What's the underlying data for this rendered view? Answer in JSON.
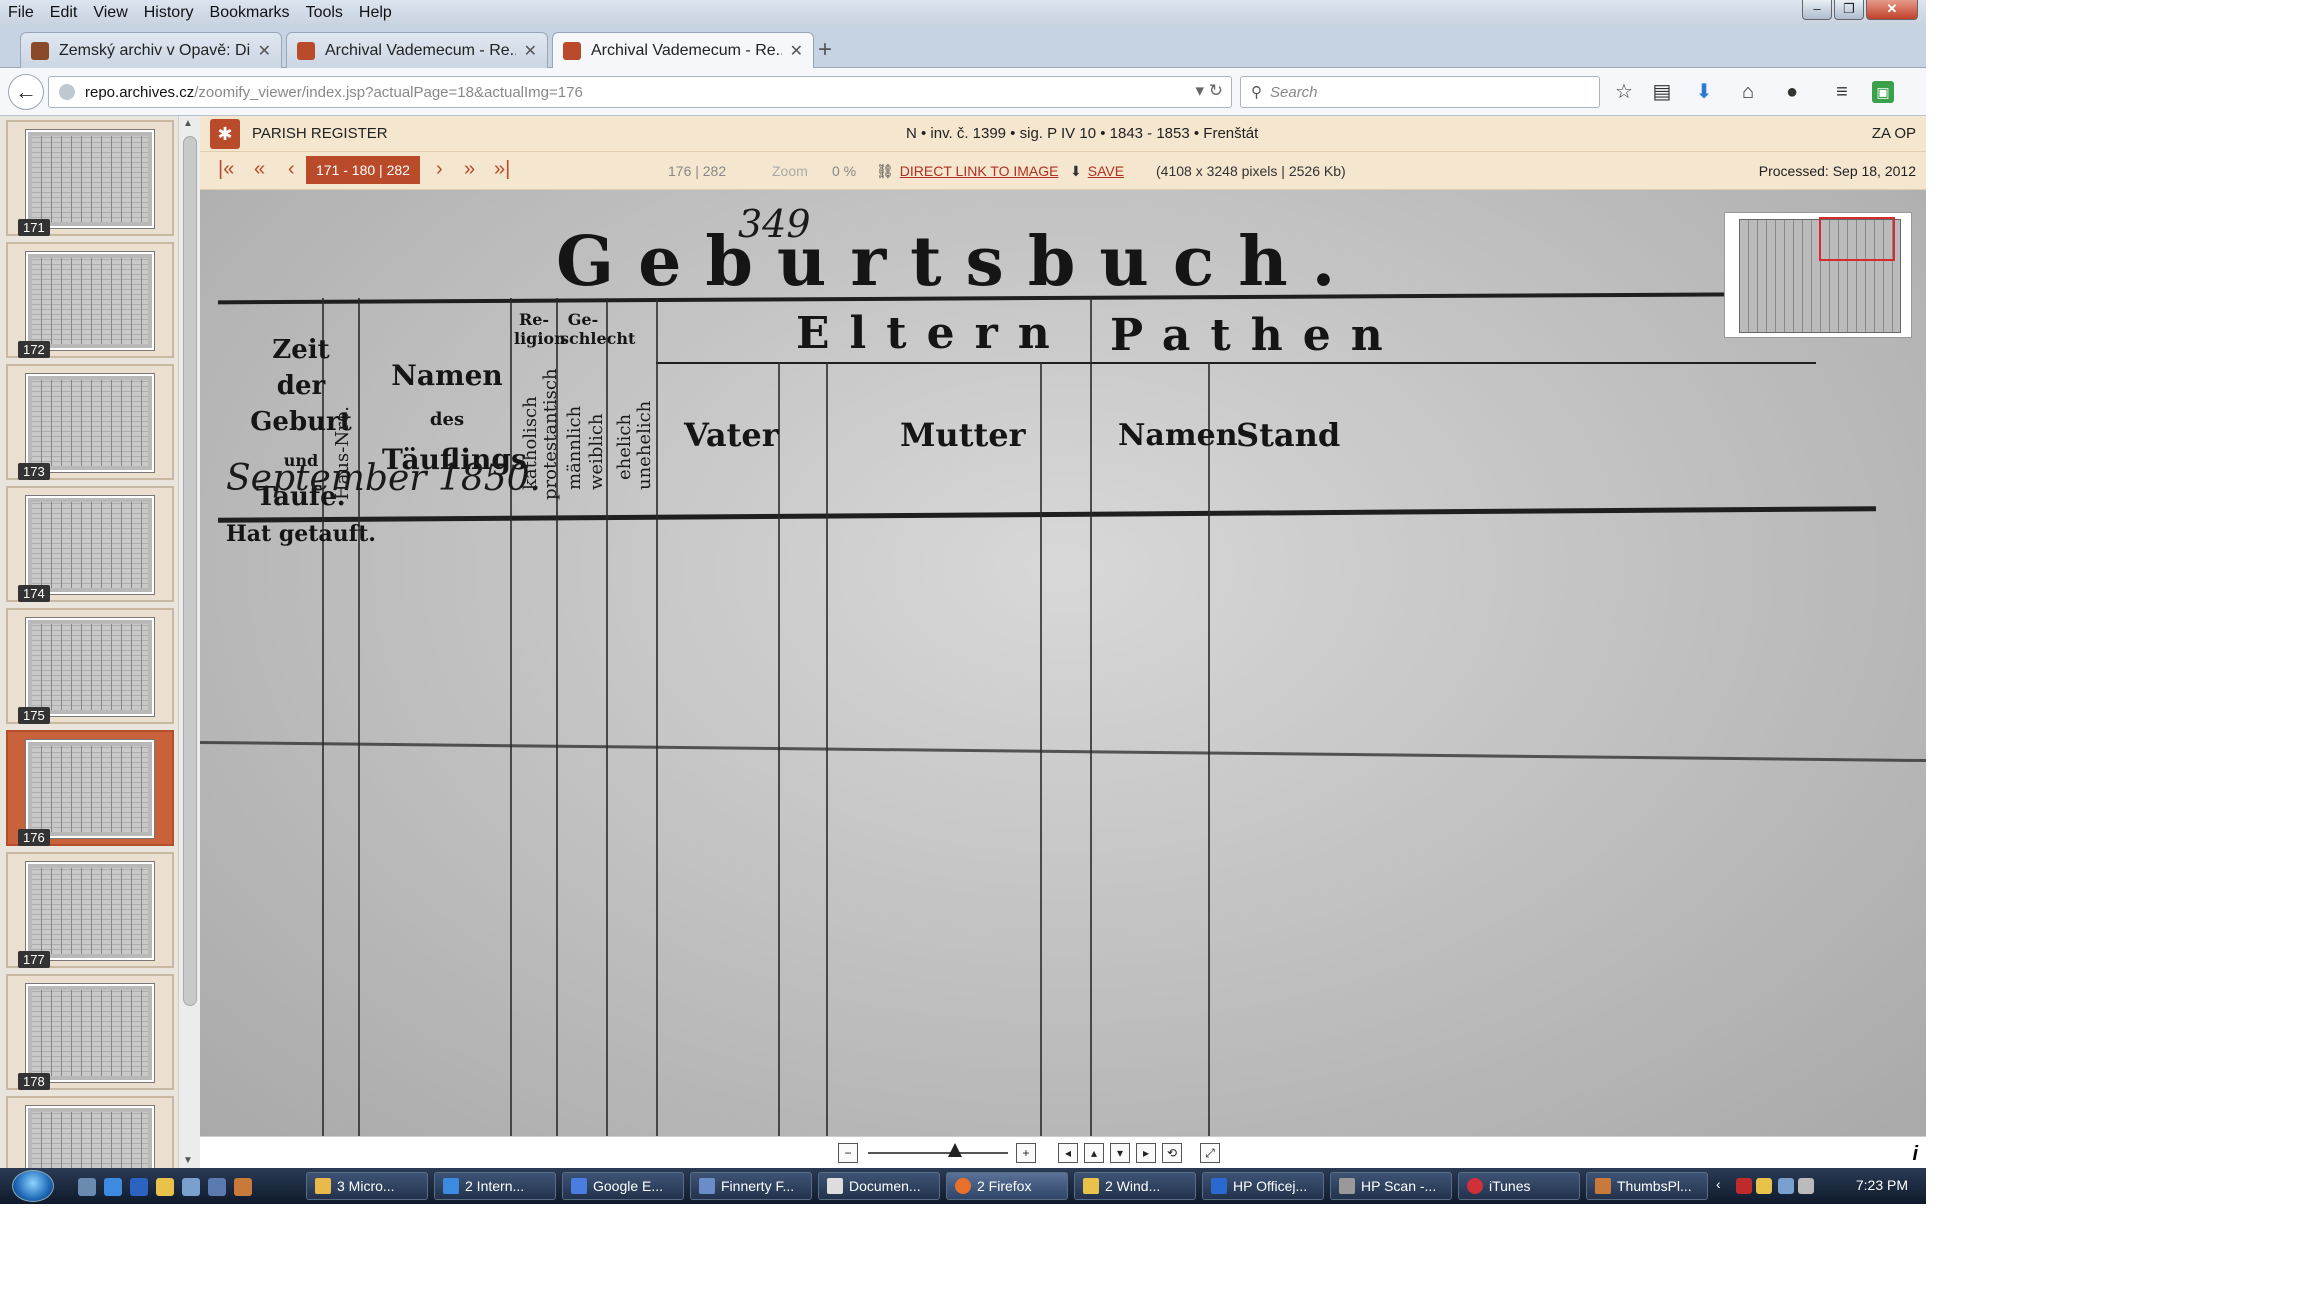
{
  "menubar": {
    "items": [
      "File",
      "Edit",
      "View",
      "History",
      "Bookmarks",
      "Tools",
      "Help"
    ]
  },
  "window_controls": {
    "minimize": "–",
    "restore": "❐",
    "close": "✕"
  },
  "tabs": [
    {
      "label": "Zemský archiv v Opavě: Di...",
      "icon": "archive-favicon",
      "color": "#8a4a2a"
    },
    {
      "label": "Archival Vademecum - Re...",
      "icon": "vademecum-favicon",
      "color": "#b94a2a"
    },
    {
      "label": "Archival Vademecum - Re...",
      "icon": "vademecum-favicon",
      "color": "#b94a2a",
      "active": true
    }
  ],
  "tab_close": "✕",
  "new_tab": "+",
  "navbar": {
    "url_domain": "repo.archives.cz",
    "url_path": "/zoomify_viewer/index.jsp?actualPage=18&actualImg=176",
    "search_placeholder": "Search",
    "icons": [
      "star-icon",
      "reading-list-icon",
      "download-icon",
      "home-icon",
      "chat-icon",
      "menu-icon",
      "extension-icon"
    ]
  },
  "sidebar": {
    "thumbnails": [
      {
        "num": "171"
      },
      {
        "num": "172"
      },
      {
        "num": "173"
      },
      {
        "num": "174"
      },
      {
        "num": "175"
      },
      {
        "num": "176",
        "selected": true
      },
      {
        "num": "177"
      },
      {
        "num": "178"
      },
      {
        "num": ""
      }
    ]
  },
  "infobar": {
    "label": "PARISH REGISTER",
    "meta": "N • inv. č. 1399 • sig. P IV 10 • 1843 - 1853 • Frenštát",
    "archive": "ZA OP"
  },
  "controls": {
    "first": "|«",
    "prev_range": "«",
    "prev": "‹",
    "range": "171 - 180 | 282",
    "next": "›",
    "next_range": "»",
    "last": "»|",
    "position": "176 | 282",
    "zoom_label": "Zoom",
    "zoom_value": "0 %",
    "direct_link": "DIRECT LINK TO IMAGE",
    "save": "SAVE",
    "dimensions": "(4108 x 3248 pixels | 2526 Kb)",
    "processed": "Processed: Sep 18, 2012"
  },
  "document": {
    "page_number": "349",
    "title": "Geburtsbuch.",
    "col_zeit": [
      "Zeit",
      "der Geburt",
      "und",
      "Taufe.",
      "Hat getauft."
    ],
    "col_hausnr": "Haus-Nro.",
    "col_namen": [
      "Namen",
      "des",
      "Täuflings"
    ],
    "col_religion": "Re-ligion",
    "col_geschlecht": "Ge-schlecht",
    "sub_cols": [
      "katholisch",
      "protestantisch",
      "männlich",
      "weiblich",
      "ehelich",
      "unehelich"
    ],
    "eltern": "Eltern",
    "vater": "Vater",
    "mutter": "Mutter",
    "pathen": "Pathen",
    "pathen_namen": "Namen",
    "stand": "Stand",
    "month_year": "September 1850."
  },
  "bottombar": {
    "zoom_out": "−",
    "zoom_in": "+",
    "pan_left": "◂",
    "pan_up": "▴",
    "pan_down": "▾",
    "pan_right": "▸",
    "reset": "⟲",
    "fullscreen": "⤢",
    "info": "i"
  },
  "taskbar": {
    "tasks": [
      {
        "label": "3 Micro...",
        "color": "#e9b949"
      },
      {
        "label": "2 Intern...",
        "color": "#3d8be0"
      },
      {
        "label": "Google E...",
        "color": "#4a7de0"
      },
      {
        "label": "Finnerty F...",
        "color": "#6a8cc8"
      },
      {
        "label": "Documen...",
        "color": "#dddddd"
      },
      {
        "label": "2 Firefox",
        "color": "#e8702a",
        "active": true
      },
      {
        "label": "2 Wind...",
        "color": "#e9c349"
      },
      {
        "label": "HP Officej...",
        "color": "#2a6ad0"
      },
      {
        "label": "HP Scan -...",
        "color": "#999999"
      },
      {
        "label": "iTunes",
        "color": "#d0303a"
      },
      {
        "label": "ThumbsPl...",
        "color": "#c97a3a"
      }
    ],
    "clock": "7:23 PM"
  }
}
